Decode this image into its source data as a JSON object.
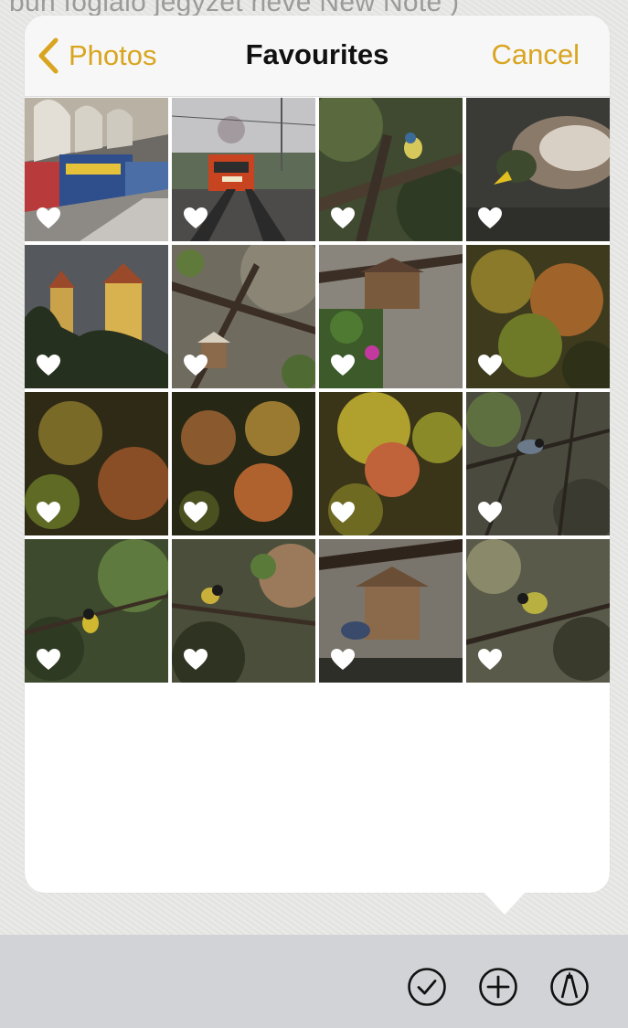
{
  "note": {
    "background_text": "bun foglaló jegyzet neve New Note )"
  },
  "navbar": {
    "back_label": "Photos",
    "title": "Favourites",
    "cancel_label": "Cancel",
    "accent_color": "#d9a520"
  },
  "photos": [
    {
      "subject": "train station locomotive",
      "favourite": true
    },
    {
      "subject": "red diesel locomotive",
      "favourite": true
    },
    {
      "subject": "blue tit on branch",
      "favourite": true
    },
    {
      "subject": "mallard duck",
      "favourite": true
    },
    {
      "subject": "church towers",
      "favourite": true
    },
    {
      "subject": "bird feeder in branches",
      "favourite": true
    },
    {
      "subject": "bird feeder with flowers",
      "favourite": true
    },
    {
      "subject": "autumn leaves",
      "favourite": true
    },
    {
      "subject": "autumn leaves",
      "favourite": true
    },
    {
      "subject": "autumn leaves",
      "favourite": true
    },
    {
      "subject": "autumn leaves",
      "favourite": true
    },
    {
      "subject": "great tit on twigs",
      "favourite": true
    },
    {
      "subject": "great tit in bush",
      "favourite": true
    },
    {
      "subject": "great tit in ivy",
      "favourite": true
    },
    {
      "subject": "bird at feeder",
      "favourite": true
    },
    {
      "subject": "great tit on branch",
      "favourite": true
    }
  ],
  "toolbar": {
    "icons": [
      "checkmark-circle-icon",
      "plus-circle-icon",
      "markup-pen-icon"
    ]
  }
}
